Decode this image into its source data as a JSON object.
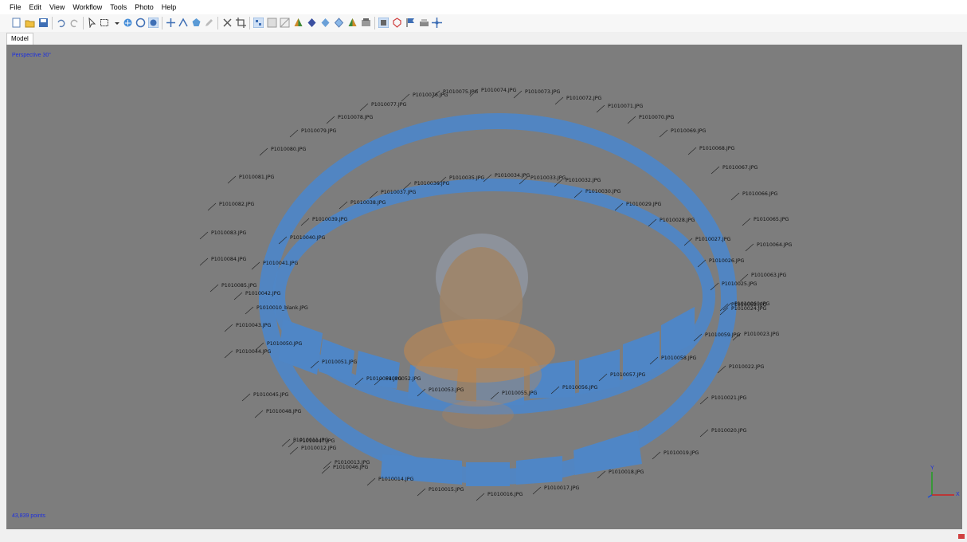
{
  "menu": [
    "File",
    "Edit",
    "View",
    "Workflow",
    "Tools",
    "Photo",
    "Help"
  ],
  "toolbar_icons": [
    "new-document-icon",
    "open-folder-icon",
    "save-icon",
    "undo-icon",
    "redo-icon",
    "navigation-pointer-icon",
    "rectangle-selection-icon",
    "navigate-icon",
    "rotate-object-icon",
    "rotate-sphere-icon",
    "add-marker-icon",
    "ruler-icon",
    "shape-icon",
    "pencil-icon",
    "delete-selection-icon",
    "crop-selection-icon",
    "show-cameras-icon",
    "show-grid-icon",
    "show-region-icon",
    "solid-icon",
    "shaded-icon",
    "point-cloud-icon",
    "dense-cloud-icon",
    "tiled-model-icon",
    "show-images-icon",
    "show-shapes-icon",
    "show-markers-icon",
    "show-dem-icon",
    "move-region-icon"
  ],
  "tabs": {
    "model": "Model"
  },
  "viewport": {
    "projection_label": "Perspective 30°",
    "points_label": "43,839 points"
  },
  "axis": {
    "y": "Y",
    "x": "X"
  },
  "colors": {
    "camera_plane": "#4f86c6",
    "viewport_bg": "#7d7d7d",
    "overlay_text": "#1c2fe0"
  },
  "camera_labels": [
    "P1010076.JPG",
    "P1010075.JPG",
    "P1010074.JPG",
    "P1010073.JPG",
    "P1010072.JPG",
    "P1010071.JPG",
    "P1010070.JPG",
    "P1010069.JPG",
    "P1010068.JPG",
    "P1010067.JPG",
    "P1010066.JPG",
    "P1010065.JPG",
    "P1010064.JPG",
    "P1010063.JPG",
    "P1010062.JPG",
    "P1010077.JPG",
    "P1010078.JPG",
    "P1010079.JPG",
    "P1010080.JPG",
    "P1010081.JPG",
    "P1010082.JPG",
    "P1010083.JPG",
    "P1010084.JPG",
    "P1010085.JPG",
    "P1010035.JPG",
    "P1010034.JPG",
    "P1010033.JPG",
    "P1010032.JPG",
    "P1010030.JPG",
    "P1010036.JPG",
    "P1010037.JPG",
    "P1010038.JPG",
    "P1010039.JPG",
    "P1010040.JPG",
    "P1010041.JPG",
    "P1010042.JPG",
    "P1010029.JPG",
    "P1010028.JPG",
    "P1010027.JPG",
    "P1010026.JPG",
    "P1010025.JPG",
    "P1010024.JPG",
    "P1010023.JPG",
    "P1010022.JPG",
    "P1010021.JPG",
    "P1010020.JPG",
    "P1010019.JPG",
    "P1010018.JPG",
    "P1010017.JPG",
    "P1010016.JPG",
    "P1010015.JPG",
    "P1010014.JPG",
    "P1010013.JPG",
    "P1010012.JPG",
    "P1010011.JPG",
    "P1010043.JPG",
    "P1010044.JPG",
    "P1010045.JPG",
    "P1010046.JPG",
    "P1010047.JPG",
    "P1010048.JPG",
    "P1010050.JPG",
    "P1010051.JPG",
    "P1010052.JPG",
    "P1010053.JPG",
    "P1010054.JPG",
    "P1010055.JPG",
    "P1010056.JPG",
    "P1010057.JPG",
    "P1010058.JPG",
    "P1010059.JPG",
    "P1010060.JPG",
    "P1010010_blank.JPG"
  ]
}
